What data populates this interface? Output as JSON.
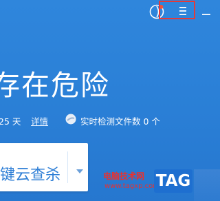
{
  "header": {
    "icons": [
      "skin-icon",
      "menu-icon",
      "minimize-icon"
    ],
    "highlight_color": "#e23b3b"
  },
  "main": {
    "headline": "存在危险",
    "days_text": "25 天",
    "detail_link": "详情",
    "realtime_text": "实时检测文件数 0 个"
  },
  "scan_button": {
    "label": "键云查杀"
  },
  "watermark": {
    "site_name": "电脑技术网",
    "site_url": "www.tagxp.com",
    "tag": "TAG"
  },
  "colors": {
    "background": "#2a7fd6",
    "button_text": "#2f7fd6",
    "watermark_red": "#e8312f",
    "tag_blue": "#1e6fd0"
  }
}
